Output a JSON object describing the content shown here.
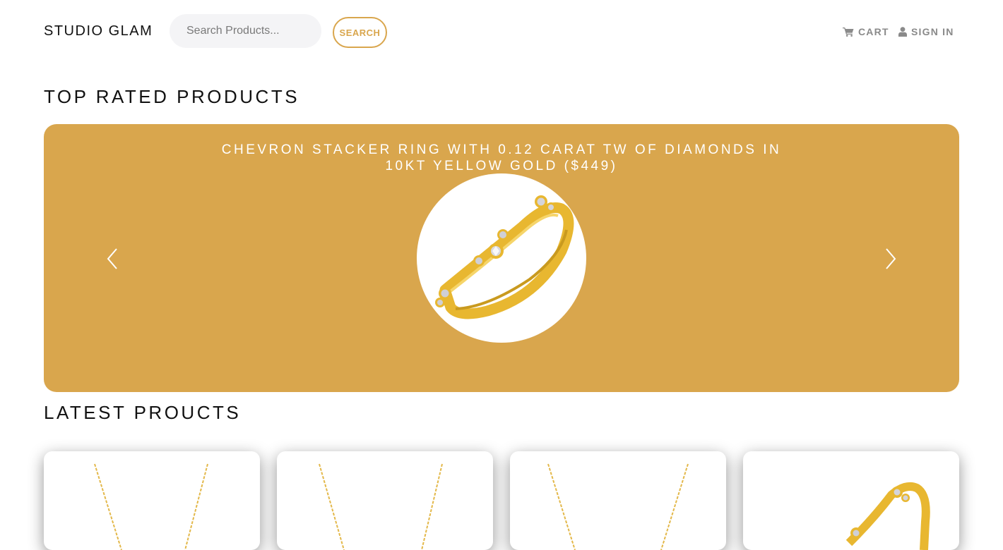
{
  "header": {
    "brand": "STUDIO GLAM",
    "search_placeholder": "Search Products...",
    "search_button_label": "SEARCH",
    "cart_label": "CART",
    "cart_icon": "shopping-cart-icon",
    "signin_label": "SIGN IN",
    "signin_icon": "user-icon"
  },
  "top_rated": {
    "title": "TOP RATED PRODUCTS",
    "slide": {
      "caption": "CHEVRON STACKER RING WITH 0.12 CARAT TW OF DIAMONDS IN 10KT YELLOW GOLD ($449)"
    },
    "prev_icon": "chevron-left-icon",
    "next_icon": "chevron-right-icon"
  },
  "latest": {
    "title": "LATEST PROUCTS",
    "products": [
      {
        "image": "gold-necklace"
      },
      {
        "image": "gold-necklace"
      },
      {
        "image": "gold-necklace"
      },
      {
        "image": "gold-ring"
      }
    ]
  },
  "colors": {
    "accent": "#d9a64d",
    "search_bg": "#f4f4f6",
    "nav_text": "#8a8a8a",
    "gold_metal": "#e8b730"
  }
}
